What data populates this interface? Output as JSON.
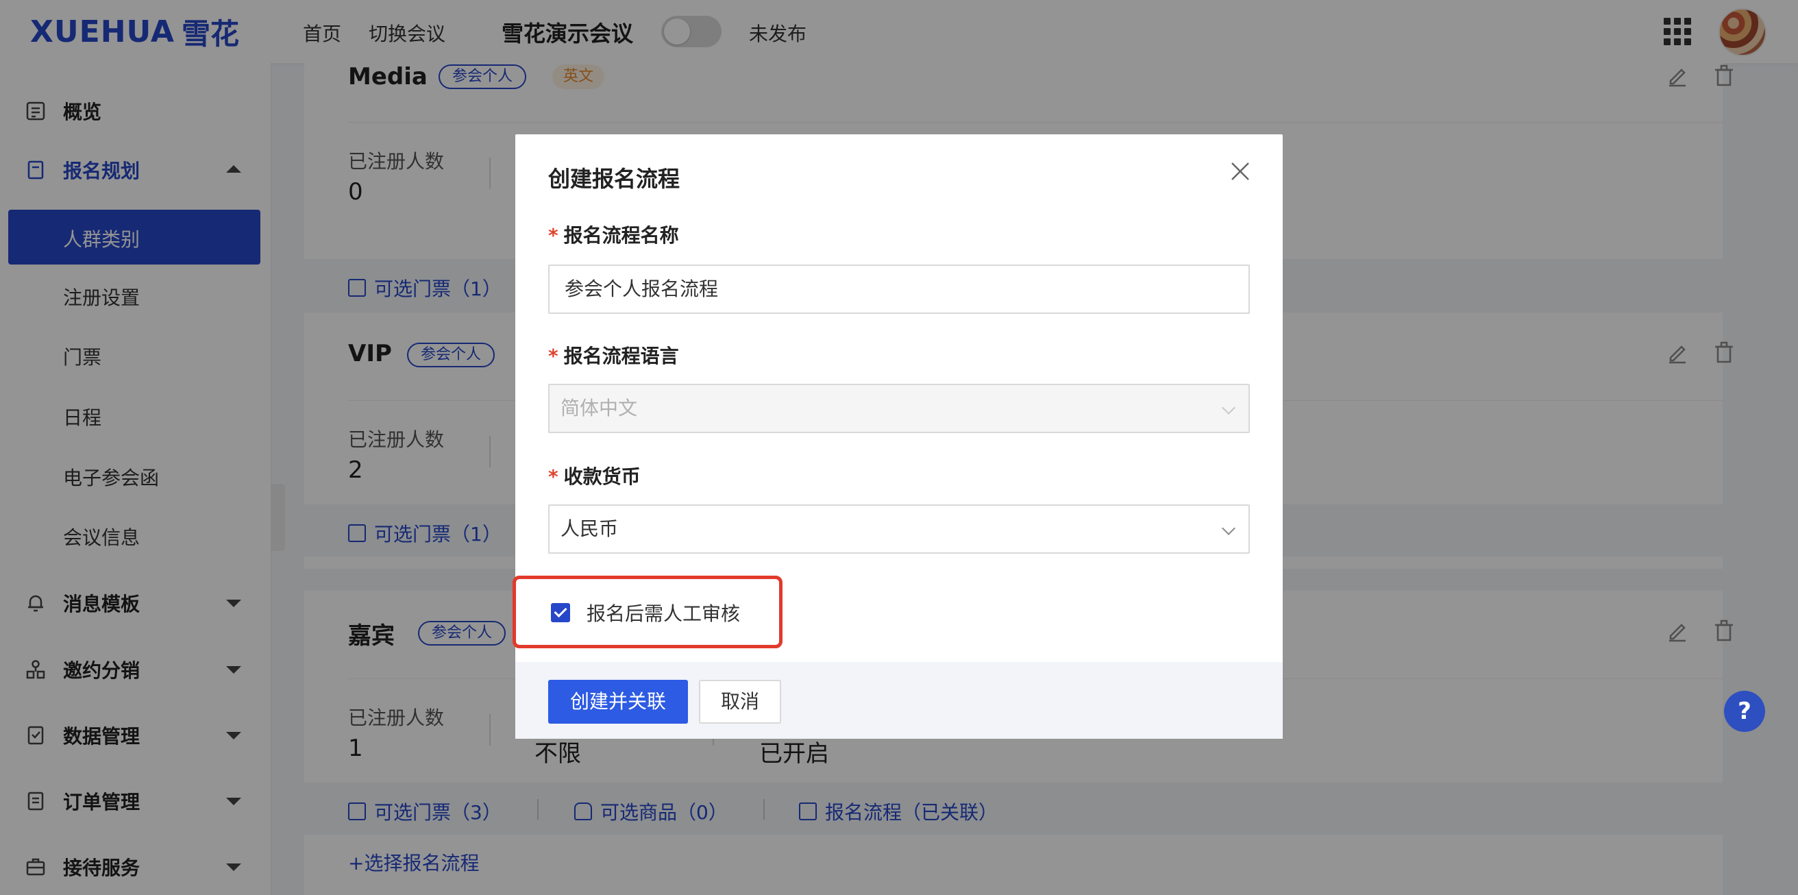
{
  "header": {
    "logo_en": "XUEHUA",
    "logo_cn": "雪花",
    "nav_home": "首页",
    "nav_switch": "切换会议",
    "meeting_name": "雪花演示会议",
    "publish_status": "未发布"
  },
  "sidebar": {
    "overview": "概览",
    "registration_plan": "报名规划",
    "sub_items": [
      "人群类别",
      "注册设置",
      "门票",
      "日程",
      "电子参会函",
      "会议信息"
    ],
    "message_template": "消息模板",
    "invite_distribution": "邀约分销",
    "data_management": "数据管理",
    "order_management": "订单管理",
    "reception_service": "接待服务"
  },
  "cards": [
    {
      "title": "Media",
      "tag": "参会个人",
      "tag2": "英文",
      "stat_label": "已注册人数",
      "stat_value": "0",
      "footer_tickets": "可选门票（1）"
    },
    {
      "title": "VIP",
      "tag": "参会个人",
      "stat_label": "已注册人数",
      "stat_value": "2",
      "footer_tickets": "可选门票（1）"
    },
    {
      "title": "嘉宾",
      "tag": "参会个人",
      "stat_label": "已注册人数",
      "stat_value": "1",
      "stat_value_2": "不限",
      "stat_value_3": "已开启",
      "footer_tickets": "可选门票（3）",
      "footer_goods": "可选商品（0）",
      "footer_flow": "报名流程（已关联）",
      "select_flow": "+选择报名流程"
    }
  ],
  "modal": {
    "title": "创建报名流程",
    "name_label": "报名流程名称",
    "name_value": "参会个人报名流程",
    "lang_label": "报名流程语言",
    "lang_value": "简体中文",
    "currency_label": "收款货币",
    "currency_value": "人民币",
    "review_label": "报名后需人工审核",
    "review_checked": true,
    "create_button": "创建并关联",
    "cancel_button": "取消",
    "required_mark": "*"
  },
  "help": "?",
  "colors": {
    "brand": "#2647c8",
    "primary_button": "#2d5be3",
    "highlight": "#e23a2b",
    "required": "#e0452f"
  }
}
